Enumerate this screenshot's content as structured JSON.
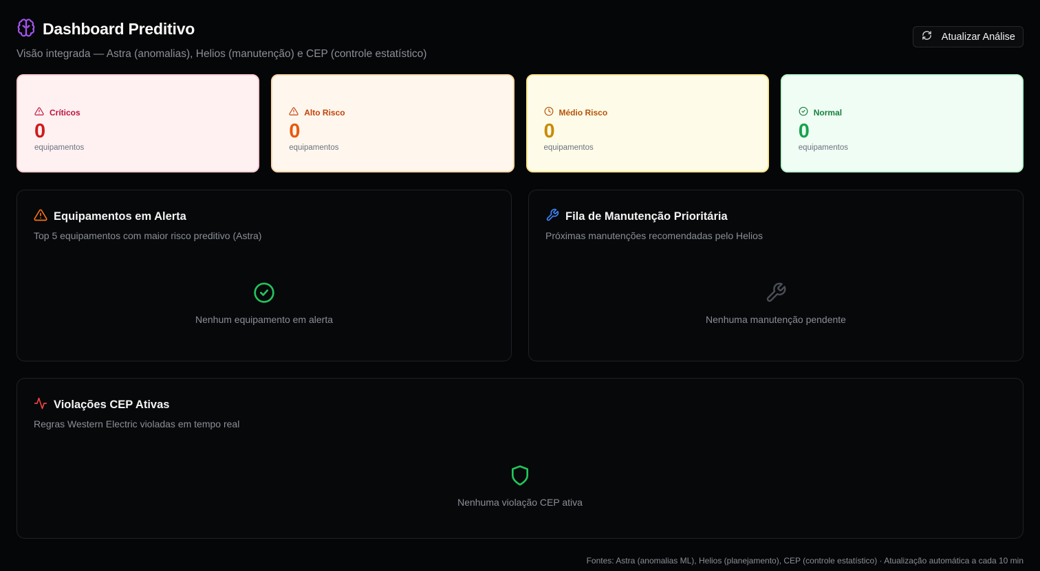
{
  "header": {
    "title": "Dashboard Preditivo",
    "subtitle": "Visão integrada — Astra (anomalias), Helios (manutenção) e CEP (controle estatístico)",
    "icon": "brain-icon",
    "refresh_label": "Atualizar Análise"
  },
  "kpis": [
    {
      "label": "Críticos",
      "value": "0",
      "unit": "equipamentos",
      "icon": "alert-triangle-icon",
      "color": "#d01a1a"
    },
    {
      "label": "Alto Risco",
      "value": "0",
      "unit": "equipamentos",
      "icon": "alert-triangle-icon",
      "color": "#ea580c"
    },
    {
      "label": "Médio Risco",
      "value": "0",
      "unit": "equipamentos",
      "icon": "clock-icon",
      "color": "#ca8a04"
    },
    {
      "label": "Normal",
      "value": "0",
      "unit": "equipamentos",
      "icon": "check-circle-icon",
      "color": "#16a34a"
    }
  ],
  "alert_panel": {
    "title": "Equipamentos em Alerta",
    "description": "Top 5 equipamentos com maior risco preditivo (Astra)",
    "empty_text": "Nenhum equipamento em alerta",
    "icon": "alert-triangle-icon",
    "empty_icon": "check-circle-icon"
  },
  "maintenance_panel": {
    "title": "Fila de Manutenção Prioritária",
    "description": "Próximas manutenções recomendadas pelo Helios",
    "empty_text": "Nenhuma manutenção pendente",
    "icon": "wrench-icon",
    "empty_icon": "wrench-icon"
  },
  "cep_panel": {
    "title": "Violações CEP Ativas",
    "description": "Regras Western Electric violadas em tempo real",
    "empty_text": "Nenhuma violação CEP ativa",
    "icon": "activity-icon",
    "empty_icon": "shield-icon"
  },
  "footer": {
    "text": "Fontes: Astra (anomalias ML), Helios (planejamento), CEP (controle estatístico) · Atualização automática a cada 10 min"
  },
  "colors": {
    "brand": "#a855f7",
    "critical": "#d01a1a",
    "high": "#ea580c",
    "medium": "#ca8a04",
    "normal": "#16a34a",
    "maintenance_accent": "#3b82f6",
    "success": "#22c55e"
  }
}
